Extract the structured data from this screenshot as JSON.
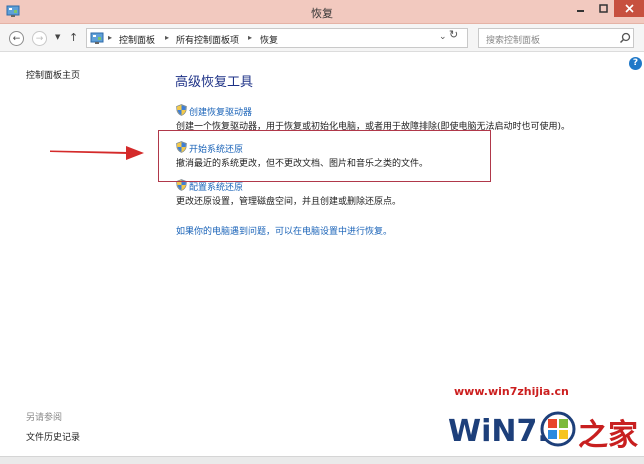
{
  "window": {
    "title": "恢复"
  },
  "address": {
    "breadcrumbs": [
      "控制面板",
      "所有控制面板项",
      "恢复"
    ],
    "search_placeholder": "搜索控制面板"
  },
  "left_pane": {
    "home_link": "控制面板主页",
    "see_also_heading": "另请参阅",
    "see_also_items": [
      "文件历史记录"
    ]
  },
  "main": {
    "heading": "高级恢复工具",
    "tools": [
      {
        "link": "创建恢复驱动器",
        "description": "创建一个恢复驱动器，用于恢复或初始化电脑，或者用于故障排除(即使电脑无法启动时也可使用)。"
      },
      {
        "link": "开始系统还原",
        "description": "撤消最近的系统更改，但不更改文档、图片和音乐之类的文件。"
      },
      {
        "link": "配置系统还原",
        "description": "更改还原设置，管理磁盘空间，并且创建或删除还原点。"
      }
    ],
    "footer_link": "如果你的电脑遇到问题，可以在电脑设置中进行恢复。"
  },
  "watermark": {
    "url": "www.win7zhijia.cn"
  },
  "colors": {
    "titlebar": "#f2c9bf",
    "close_button": "#c7503f",
    "link": "#1a63b8",
    "heading": "#1e3287",
    "highlight": "#b0384a",
    "arrow": "#d42a2a"
  },
  "icons": [
    "control-panel-icon",
    "search-icon",
    "shield-icon",
    "help-icon"
  ]
}
